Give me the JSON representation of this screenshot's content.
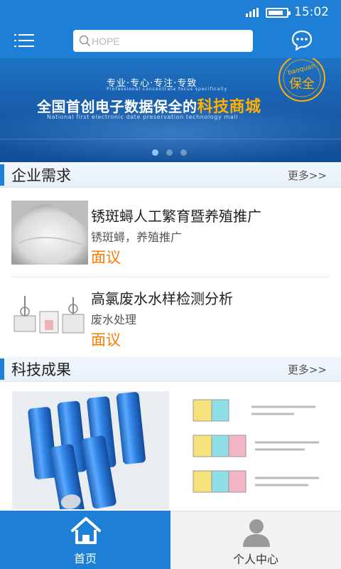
{
  "status_bar": {
    "time": "15:02",
    "battery_level": 0.85,
    "icons": [
      "signal-icon",
      "battery-icon"
    ]
  },
  "header": {
    "search": {
      "placeholder": "HOPE",
      "value": ""
    },
    "icons": [
      "menu-icon",
      "search-icon",
      "chat-icon"
    ]
  },
  "banner": {
    "slogan": "专业·专心·专注·专致",
    "slogan_en": "Professional   concentrate   focus   specifically",
    "headline_main": "全国首创电子数据保全的",
    "headline_highlight": "科技商城",
    "headline_en": "National first electronic date preservation technology mall",
    "seal_text": "保全",
    "seal_brand": "baoquan",
    "slide_count": 3,
    "active_slide": 1,
    "colors": {
      "highlight": "#ffb000",
      "background": "#175aa8"
    }
  },
  "demand_section": {
    "title": "企业需求",
    "more": "更多>>",
    "items": [
      {
        "name": "锈斑蟳人工繁育暨养殖推广",
        "tag": "锈斑蟳，养殖推广",
        "price": "面议",
        "image": "white-powder-photo"
      },
      {
        "name": "高氯废水水样检测分析",
        "tag": "废水处理",
        "price": "面议",
        "image": "lab-equipment-photo"
      }
    ]
  },
  "achievement_section": {
    "title": "科技成果",
    "more": "更多>>",
    "images": [
      "blue-battery-cells-photo",
      "battery-electrochemistry-diagram"
    ]
  },
  "bottom_nav": {
    "home": {
      "label": "首页",
      "icon": "home-icon",
      "active": true
    },
    "me": {
      "label": "个人中心",
      "icon": "user-icon",
      "active": false
    }
  },
  "colors": {
    "primary": "#1e7fd6",
    "price": "#ff7a00"
  }
}
